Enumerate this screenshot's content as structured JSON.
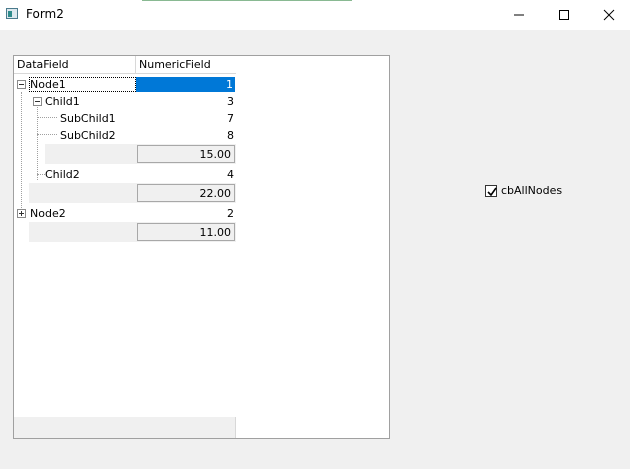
{
  "window": {
    "title": "Form2",
    "minimize_icon": "minimize-icon",
    "maximize_icon": "maximize-icon",
    "close_icon": "close-icon"
  },
  "grid": {
    "columns": [
      "DataField",
      "NumericField"
    ],
    "rows": [
      {
        "label": "Node1",
        "value": "1"
      },
      {
        "label": "Child1",
        "value": "3"
      },
      {
        "label": "SubChild1",
        "value": "7"
      },
      {
        "label": "SubChild2",
        "value": "8"
      },
      {
        "footer": "15.00"
      },
      {
        "label": "Child2",
        "value": "4"
      },
      {
        "footer": "22.00"
      },
      {
        "label": "Node2",
        "value": "2"
      },
      {
        "footer": "11.00"
      }
    ]
  },
  "options": {
    "all_nodes_label": "cbAllNodes",
    "all_nodes_checked": true
  }
}
